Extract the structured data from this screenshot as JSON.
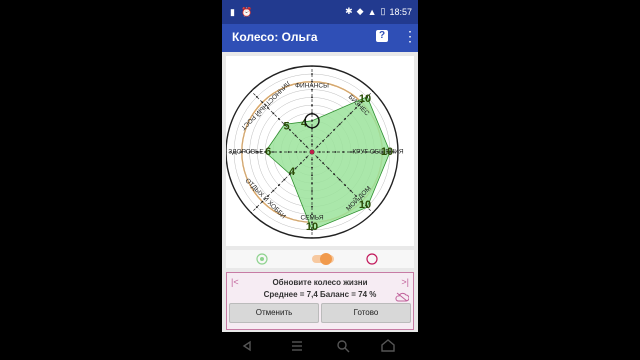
{
  "status": {
    "time": "18:57",
    "left_icons": [
      "sim-card-icon",
      "alarm-icon"
    ],
    "right_icons": [
      "bluetooth-icon",
      "network-icon",
      "signal-icon",
      "battery-icon"
    ]
  },
  "appbar": {
    "title": "Колесо: Ольга",
    "help_label": "?",
    "more_label": "⋮"
  },
  "wheel": {
    "max_value": 10,
    "fill_color": "#9be39b",
    "stroke_color": "#2f8f2f",
    "axes": [
      {
        "label": "ФИНАНСЫ",
        "value": 4
      },
      {
        "label": "БИЗНЕС",
        "value": 10
      },
      {
        "label": "КРУГ ОБЩЕНИЯ",
        "value": 10
      },
      {
        "label": "МОЙ ДОМ",
        "value": 10
      },
      {
        "label": "СЕМЬЯ",
        "value": 10
      },
      {
        "label": "ОТДЫХ И ХОББИ",
        "value": 4
      },
      {
        "label": "ЗДОРОВЬЕ",
        "value": 6
      },
      {
        "label": "ЛИЧНОСТНЫЙ РОСТ",
        "value": 5
      }
    ]
  },
  "panel": {
    "prev_label": "|<",
    "next_label": ">|",
    "heading": "Обновите колесо жизни",
    "summary": "Среднее = 7,4 Баланс = 74 %",
    "cancel_label": "Отменить",
    "done_label": "Готово"
  }
}
